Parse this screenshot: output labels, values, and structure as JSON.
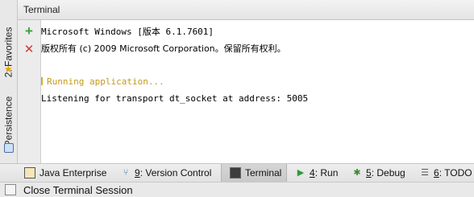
{
  "panel": {
    "title": "Terminal",
    "actions": {
      "new_session": "plus-icon",
      "close_session": "close-icon"
    }
  },
  "left_sidebar": {
    "favorites_label": "2: Favorites",
    "persistence_label": "Persistence"
  },
  "terminal": {
    "lines": [
      "Microsoft Windows [版本 6.1.7601]",
      "版权所有 (c) 2009 Microsoft Corporation。保留所有权利。",
      "",
      "Running application...",
      "Listening for transport dt_socket at address: 5005"
    ]
  },
  "bottom_tabs": [
    {
      "key": "",
      "rest": "Java Enterprise",
      "icon": "java-enterprise-icon"
    },
    {
      "key": "9",
      "rest": ": Version Control",
      "icon": "version-control-icon"
    },
    {
      "key": "",
      "rest": "Terminal",
      "icon": "terminal-icon",
      "active": true
    },
    {
      "key": "4",
      "rest": ": Run",
      "icon": "run-icon"
    },
    {
      "key": "5",
      "rest": ": Debug",
      "icon": "debug-icon"
    },
    {
      "key": "6",
      "rest": ": TODO",
      "icon": "todo-icon"
    }
  ],
  "status_bar": {
    "text": "Close Terminal Session"
  },
  "colors": {
    "running_text": "#c29a1a",
    "add_button": "#3aa23a",
    "close_button": "#d23a3a"
  }
}
